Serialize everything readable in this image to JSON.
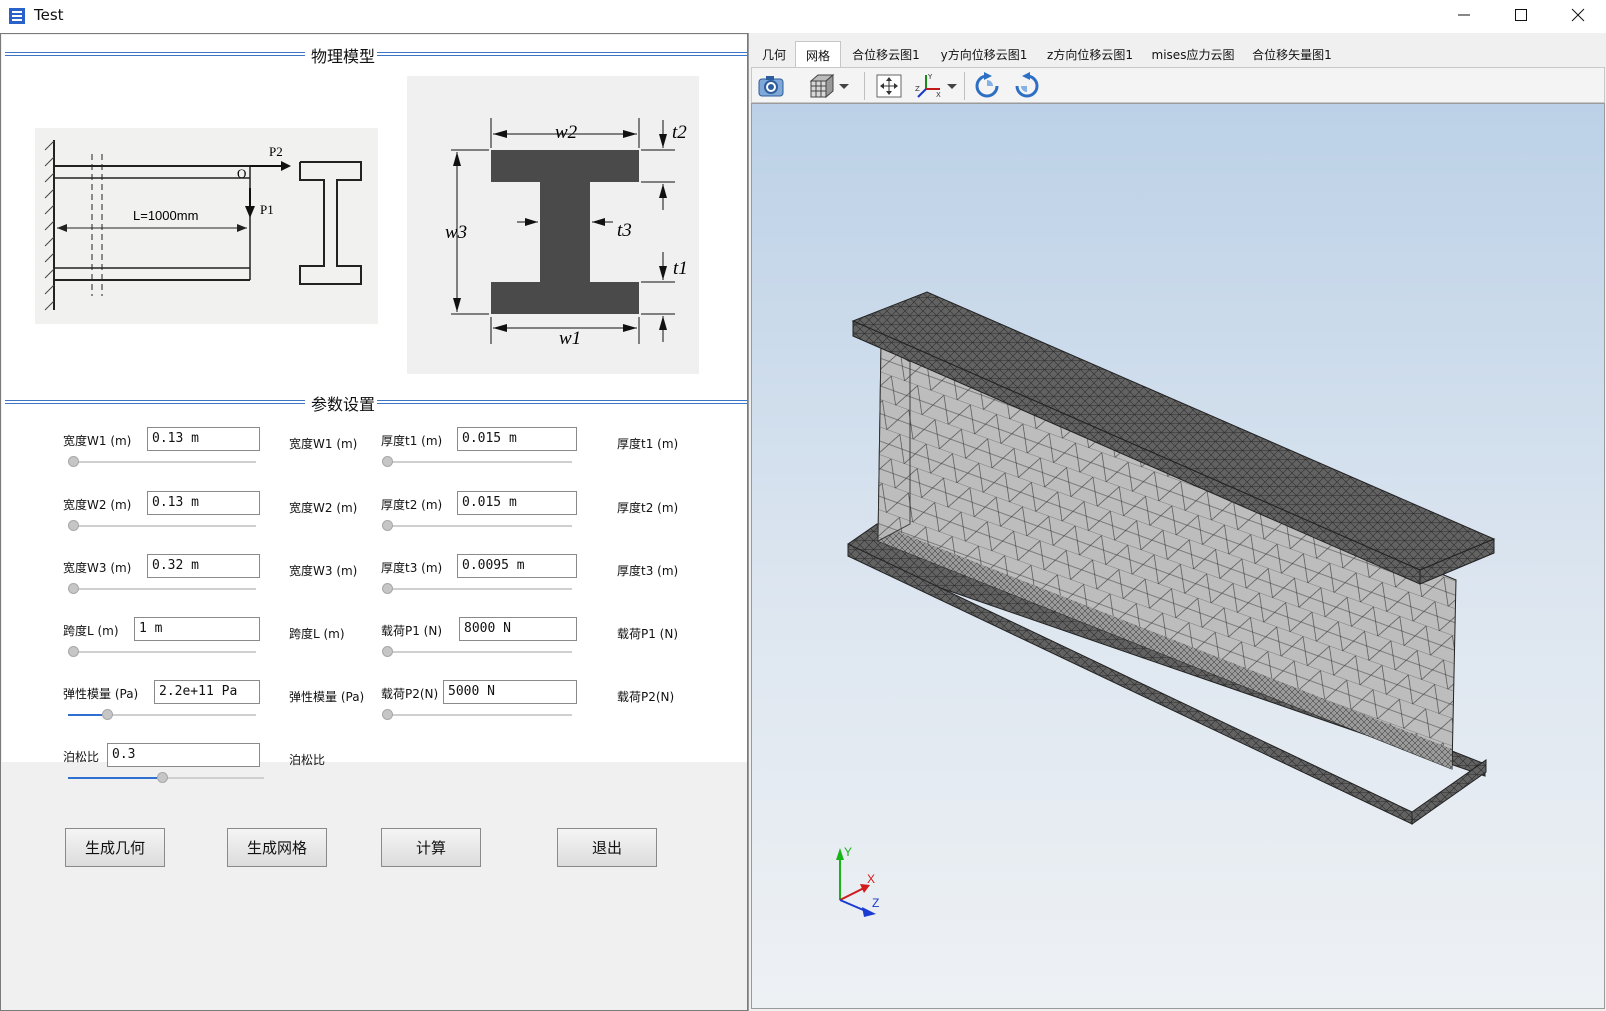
{
  "window": {
    "title": "Test"
  },
  "section_titles": {
    "model": "物理模型",
    "params": "参数设置"
  },
  "params": [
    {
      "left_label": "宽度W1 (m)",
      "left_value": "0.13 m",
      "left_side_label": "宽度W1 (m)",
      "left_fraction": 0.0,
      "right_label": "厚度t1 (m)",
      "right_value": "0.015 m",
      "right_side_label": "厚度t1 (m)",
      "right_fraction": 0.0
    },
    {
      "left_label": "宽度W2 (m)",
      "left_value": "0.13 m",
      "left_side_label": "宽度W2 (m)",
      "left_fraction": 0.0,
      "right_label": "厚度t2 (m)",
      "right_value": "0.015 m",
      "right_side_label": "厚度t2 (m)",
      "right_fraction": 0.0
    },
    {
      "left_label": "宽度W3 (m)",
      "left_value": "0.32 m",
      "left_side_label": "宽度W3 (m)",
      "left_fraction": 0.0,
      "right_label": "厚度t3 (m)",
      "right_value": "0.0095 m",
      "right_side_label": "厚度t3 (m)",
      "right_fraction": 0.0
    },
    {
      "left_label": "跨度L (m)",
      "left_value": "1 m",
      "left_side_label": "跨度L (m)",
      "left_fraction": 0.0,
      "right_label": "载荷P1 (N)",
      "right_value": "8000 N",
      "right_side_label": "载荷P1 (N)",
      "right_fraction": 0.0
    },
    {
      "left_label": "弹性模量 (Pa)",
      "left_value": "2.2e+11 Pa",
      "left_side_label": "弹性模量 (Pa)",
      "left_fraction": 0.19,
      "right_label": "载荷P2(N)",
      "right_value": "5000 N",
      "right_side_label": "载荷P2(N)",
      "right_fraction": 0.0
    }
  ],
  "poisson": {
    "label": "泊松比",
    "value": "0.3",
    "side_label": "泊松比",
    "fraction": 0.5
  },
  "buttons": {
    "gen_geometry": "生成几何",
    "gen_mesh": "生成网格",
    "compute": "计算",
    "exit": "退出"
  },
  "tabs": [
    "几何",
    "网格",
    "合位移云图1",
    "y方向位移云图1",
    "z方向位移云图1",
    "mises应力云图",
    "合位移矢量图1"
  ],
  "active_tab": "网格",
  "beam_diagram": {
    "p2": "P2",
    "p1": "P1",
    "origin": "O",
    "length": "L=1000mm"
  },
  "section_diagram": {
    "w1": "w1",
    "w2": "w2",
    "w3": "w3",
    "t1": "t1",
    "t2": "t2",
    "t3": "t3"
  },
  "axes": {
    "x": "X",
    "y": "Y",
    "z": "Z"
  },
  "colors": {
    "accent": "#3b74c9",
    "viewport_top": "#bcd1e7",
    "viewport_bottom": "#eef1f4",
    "mesh_face": "#5a5a5a"
  }
}
